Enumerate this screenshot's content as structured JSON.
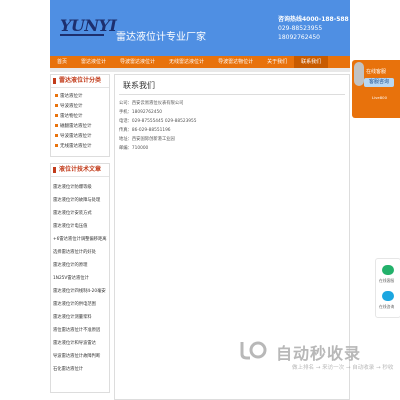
{
  "header": {
    "logo_text": "YUNYI",
    "site_title": "雷达液位计专业厂家",
    "hotline_label": "咨询热线4000-188-588",
    "hotline_numbers": "029-88523955 18092762450"
  },
  "nav": [
    {
      "label": "首页"
    },
    {
      "label": "雷达液位计"
    },
    {
      "label": "导波雷达液位计"
    },
    {
      "label": "无线雷达液位计"
    },
    {
      "label": "导波雷达物位计"
    },
    {
      "label": "关于我们"
    },
    {
      "label": "联系我们"
    }
  ],
  "sidebar": {
    "category_title": "雷达液位计分类",
    "categories": [
      "雷达液位计",
      "导波液位计",
      "雷达物位计",
      "磁翻雷达液位计",
      "导波雷达液位计",
      "无线雷达液位计"
    ],
    "articles_title": "液位计技术文章",
    "articles": [
      "雷达液位计防爆等级",
      "雷达液位计的故障与处理",
      "雷达液位计安装方式",
      "雷达液位计电压值",
      "+6雷达液位计调整偏移距离",
      "选择雷达液位计的好处",
      "雷达液位计的原理",
      "1N25V雷达液位计",
      "雷达液位计四线制4-20毫安",
      "雷达液位计的供电范围",
      "雷达液位计测量浆料",
      "液位雷达液位计不准原因",
      "雷达液位计和导波雷达",
      "导波雷达液位计故障判断",
      "石化雷达液位计"
    ]
  },
  "content": {
    "title": "联系我们",
    "lines": [
      "公司：西安云易液位仪表有限公司",
      "手机：18092762450",
      "电话：029-87555445 029-88523955",
      "传真：86-029-88551196",
      "地址：西安国际创新港工业园",
      "邮编：710000"
    ]
  },
  "widget": {
    "title": "在线客服",
    "button": "客服咨询",
    "footer": "Live800"
  },
  "chat": {
    "label1": "在线客服",
    "label2": "在线咨询"
  },
  "watermark": {
    "brand": "自动秒收录",
    "tagline": "做上排名 → 来访一次 → 自动收录 → 秒收"
  },
  "colors": {
    "header_blue": "#4f8fe3",
    "nav_orange": "#e8720c",
    "accent_red": "#c23b1a"
  }
}
